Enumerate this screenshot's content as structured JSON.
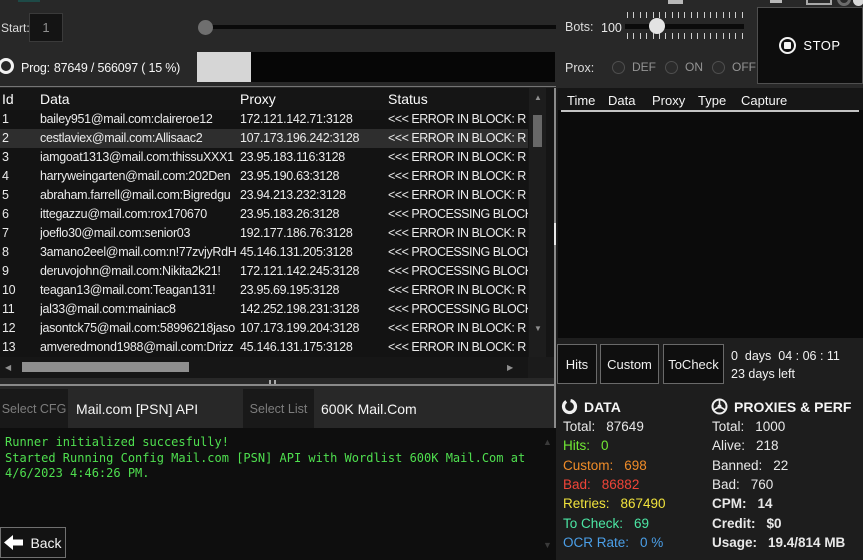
{
  "topbar": {
    "start_label": "Start:",
    "start_value": "1",
    "bots_label": "Bots:",
    "bots_value": "100",
    "prox_label": "Prox:",
    "prox_options": [
      "DEF",
      "ON",
      "OFF"
    ],
    "stop_label": "STOP",
    "progress": {
      "label": "Prog:",
      "display": "87649 / 566097 ( 15 %)",
      "percent": 15
    }
  },
  "results_table": {
    "columns": [
      "Id",
      "Data",
      "Proxy",
      "Status"
    ],
    "selected_row_id": "2",
    "rows": [
      {
        "id": "1",
        "data": "bailey951@mail.com:claireroe12",
        "proxy": "172.121.142.71:3128",
        "status": "<<< ERROR IN BLOCK: R"
      },
      {
        "id": "2",
        "data": "cestlaviex@mail.com:Allisaac2",
        "proxy": "107.173.196.242:3128",
        "status": "<<< ERROR IN BLOCK: R"
      },
      {
        "id": "3",
        "data": "iamgoat1313@mail.com:thissuXXX1",
        "proxy": "23.95.183.116:3128",
        "status": "<<< ERROR IN BLOCK: R"
      },
      {
        "id": "4",
        "data": "harryweingarten@mail.com:202Den",
        "proxy": "23.95.190.63:3128",
        "status": "<<< ERROR IN BLOCK: R"
      },
      {
        "id": "5",
        "data": "abraham.farrell@mail.com:Bigredgu",
        "proxy": "23.94.213.232:3128",
        "status": "<<< ERROR IN BLOCK: R"
      },
      {
        "id": "6",
        "data": "ittegazzu@mail.com:rox170670",
        "proxy": "23.95.183.26:3128",
        "status": "<<< PROCESSING BLOCK"
      },
      {
        "id": "7",
        "data": "joeflo30@mail.com:senior03",
        "proxy": "192.177.186.76:3128",
        "status": "<<< ERROR IN BLOCK: R"
      },
      {
        "id": "8",
        "data": "3amano2eel@mail.com:n!77zvjyRdH",
        "proxy": "45.146.131.205:3128",
        "status": "<<< PROCESSING BLOCK"
      },
      {
        "id": "9",
        "data": "deruvojohn@mail.com:Nikita2k21!",
        "proxy": "172.121.142.245:3128",
        "status": "<<< PROCESSING BLOCK"
      },
      {
        "id": "10",
        "data": "teagan13@mail.com:Teagan131!",
        "proxy": "23.95.69.195:3128",
        "status": "<<< ERROR IN BLOCK: R"
      },
      {
        "id": "11",
        "data": "jal33@mail.com:mainiac8",
        "proxy": "142.252.198.231:3128",
        "status": "<<< PROCESSING BLOCK"
      },
      {
        "id": "12",
        "data": "jasontck75@mail.com:58996218jaso",
        "proxy": "107.173.199.204:3128",
        "status": "<<< ERROR IN BLOCK: R"
      },
      {
        "id": "13",
        "data": "amveredmond1988@mail.com:Drizz",
        "proxy": "45.146.131.175:3128",
        "status": "<<< ERROR IN BLOCK: R"
      }
    ]
  },
  "hits_panel": {
    "columns": [
      "Time",
      "Data",
      "Proxy",
      "Type",
      "Capture"
    ],
    "rows": []
  },
  "tabs": [
    "Hits",
    "Custom",
    "ToCheck"
  ],
  "timer": {
    "elapsed": "0  days  04 : 06 : 11",
    "remaining": "23 days left"
  },
  "config_bar": {
    "select_cfg_label": "Select CFG",
    "config_name": "Mail.com [PSN] API",
    "select_list_label": "Select List",
    "list_name": "600K Mail.Com"
  },
  "log": {
    "text_color": "#4fdf4f",
    "lines": [
      "Runner initialized succesfully!",
      "Started Running Config Mail.com [PSN] API with Wordlist 600K Mail.Com at",
      "4/6/2023 4:46:26 PM."
    ]
  },
  "back_button": {
    "label": "Back"
  },
  "data_stats": {
    "title": "DATA",
    "items": [
      {
        "label": "Total:",
        "value": "87649",
        "color": "#e6e6e6"
      },
      {
        "label": "Hits:",
        "value": "0",
        "color": "#71e834"
      },
      {
        "label": "Custom:",
        "value": "698",
        "color": "#f08c28"
      },
      {
        "label": "Bad:",
        "value": "86882",
        "color": "#f04438"
      },
      {
        "label": "Retries:",
        "value": "867490",
        "color": "#f0e23c"
      },
      {
        "label": "To Check:",
        "value": "69",
        "color": "#4ce6a4"
      },
      {
        "label": "OCR Rate:",
        "value": "0 %",
        "color": "#4b9fe8"
      }
    ]
  },
  "proxy_stats": {
    "title": "PROXIES & PERF",
    "items": [
      {
        "label": "Total:",
        "value": "1000",
        "bold": false
      },
      {
        "label": "Alive:",
        "value": "218",
        "bold": false
      },
      {
        "label": "Banned:",
        "value": "22",
        "bold": false
      },
      {
        "label": "Bad:",
        "value": "760",
        "bold": false
      },
      {
        "label": "CPM:",
        "value": "14",
        "bold": true
      },
      {
        "label": "Credit:",
        "value": "$0",
        "bold": true
      },
      {
        "label": "Usage:",
        "value": "19.4/814 MB",
        "bold": true
      }
    ]
  }
}
